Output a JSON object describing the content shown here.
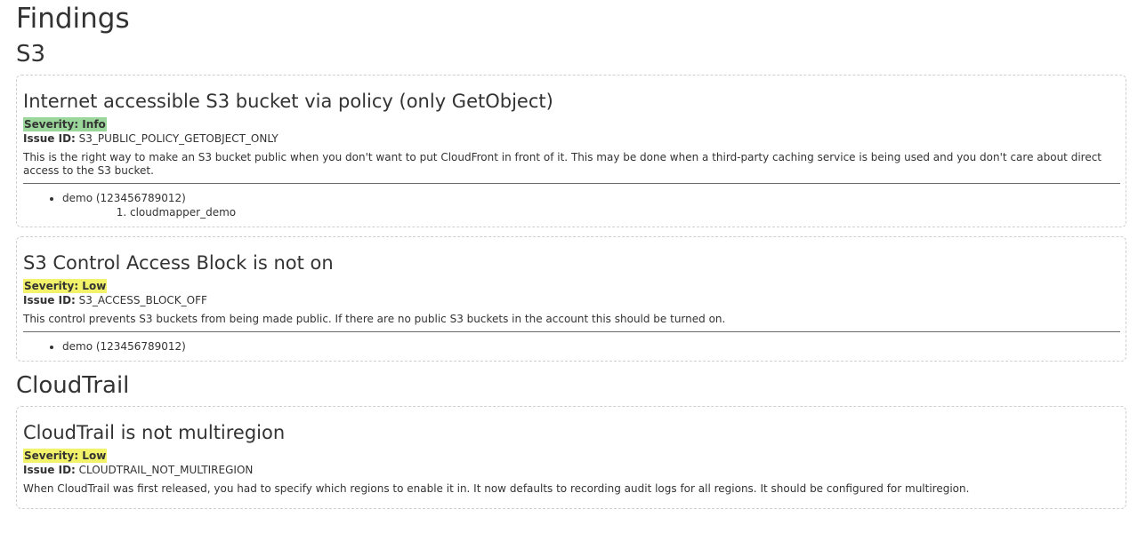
{
  "page": {
    "title": "Findings"
  },
  "sections": [
    {
      "title": "S3",
      "findings": [
        {
          "title": "Internet accessible S3 bucket via policy (only GetObject)",
          "severity": "Severity: Info",
          "severity_level": "info",
          "issue_id_label": "Issue ID:",
          "issue_id": "S3_PUBLIC_POLICY_GETOBJECT_ONLY",
          "description": "This is the right way to make an S3 bucket public when you don't want to put CloudFront in front of it. This may be done when a third-party caching service is being used and you don't care about direct access to the S3 bucket.",
          "accounts": [
            {
              "label": "demo (123456789012)",
              "resources": [
                "cloudmapper_demo"
              ]
            }
          ]
        },
        {
          "title": "S3 Control Access Block is not on",
          "severity": "Severity: Low",
          "severity_level": "low",
          "issue_id_label": "Issue ID:",
          "issue_id": "S3_ACCESS_BLOCK_OFF",
          "description": "This control prevents S3 buckets from being made public. If there are no public S3 buckets in the account this should be turned on.",
          "accounts": [
            {
              "label": "demo (123456789012)",
              "resources": []
            }
          ]
        }
      ]
    },
    {
      "title": "CloudTrail",
      "findings": [
        {
          "title": "CloudTrail is not multiregion",
          "severity": "Severity: Low",
          "severity_level": "low",
          "issue_id_label": "Issue ID:",
          "issue_id": "CLOUDTRAIL_NOT_MULTIREGION",
          "description": "When CloudTrail was first released, you had to specify which regions to enable it in. It now defaults to recording audit logs for all regions. It should be configured for multiregion.",
          "accounts": []
        }
      ]
    }
  ],
  "colors": {
    "severity_info": "#9bd69b",
    "severity_low": "#f3f36b",
    "text": "#333333",
    "border": "#cfcfcf"
  }
}
